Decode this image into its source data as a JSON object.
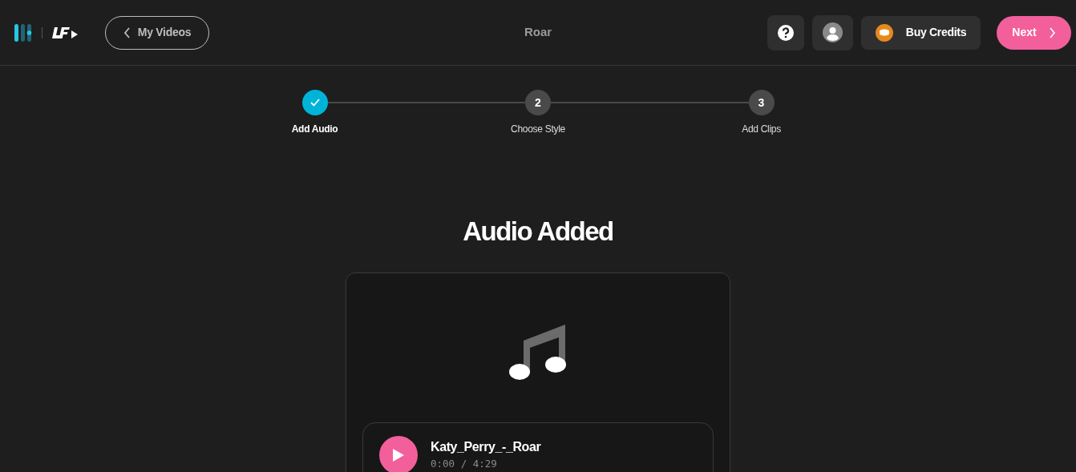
{
  "header": {
    "back_button": "My Videos",
    "title": "Roar",
    "buy_credits": "Buy Credits",
    "next_button": "Next"
  },
  "steps": [
    {
      "label": "Add Audio",
      "done": true
    },
    {
      "label": "Choose Style",
      "number": "2",
      "done": false
    },
    {
      "label": "Add Clips",
      "number": "3",
      "done": false
    }
  ],
  "heading": "Audio Added",
  "audio": {
    "file_name": "Katy_Perry_-_Roar",
    "time": "0:00 / 4:29"
  }
}
